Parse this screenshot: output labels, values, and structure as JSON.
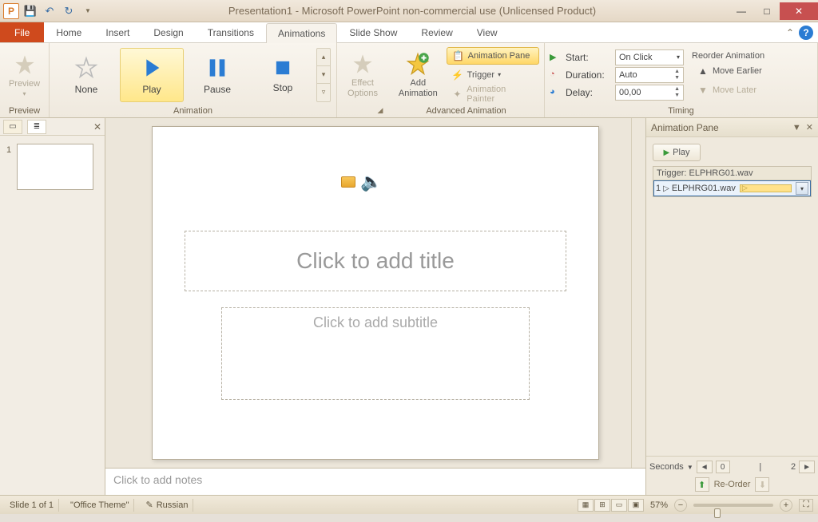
{
  "title": "Presentation1 - Microsoft PowerPoint non-commercial use (Unlicensed Product)",
  "qat": {
    "app_letter": "P"
  },
  "tabs": {
    "file": "File",
    "items": [
      "Home",
      "Insert",
      "Design",
      "Transitions",
      "Animations",
      "Slide Show",
      "Review",
      "View"
    ],
    "active": "Animations"
  },
  "ribbon": {
    "preview": {
      "label": "Preview",
      "group": "Preview"
    },
    "animation": {
      "group": "Animation",
      "none": "None",
      "play": "Play",
      "pause": "Pause",
      "stop": "Stop"
    },
    "effect_options": "Effect\nOptions",
    "advanced": {
      "group": "Advanced Animation",
      "add": "Add\nAnimation",
      "pane": "Animation Pane",
      "trigger": "Trigger",
      "painter": "Animation Painter"
    },
    "timing": {
      "group": "Timing",
      "start_lbl": "Start:",
      "start_val": "On Click",
      "duration_lbl": "Duration:",
      "duration_val": "Auto",
      "delay_lbl": "Delay:",
      "delay_val": "00,00",
      "reorder_hdr": "Reorder Animation",
      "earlier": "Move Earlier",
      "later": "Move Later"
    }
  },
  "thumb": {
    "num": "1"
  },
  "slide": {
    "title_ph": "Click to add title",
    "sub_ph": "Click to add subtitle"
  },
  "notes_ph": "Click to add notes",
  "anim_pane": {
    "title": "Animation Pane",
    "play": "Play",
    "trigger": "Trigger: ELPHRG01.wav",
    "item_num": "1",
    "item_name": "ELPHRG01.wav",
    "seconds": "Seconds",
    "tl_0": "0",
    "tl_2": "2",
    "reorder": "Re-Order"
  },
  "status": {
    "slide": "Slide 1 of 1",
    "theme": "\"Office Theme\"",
    "lang": "Russian",
    "zoom": "57%"
  }
}
